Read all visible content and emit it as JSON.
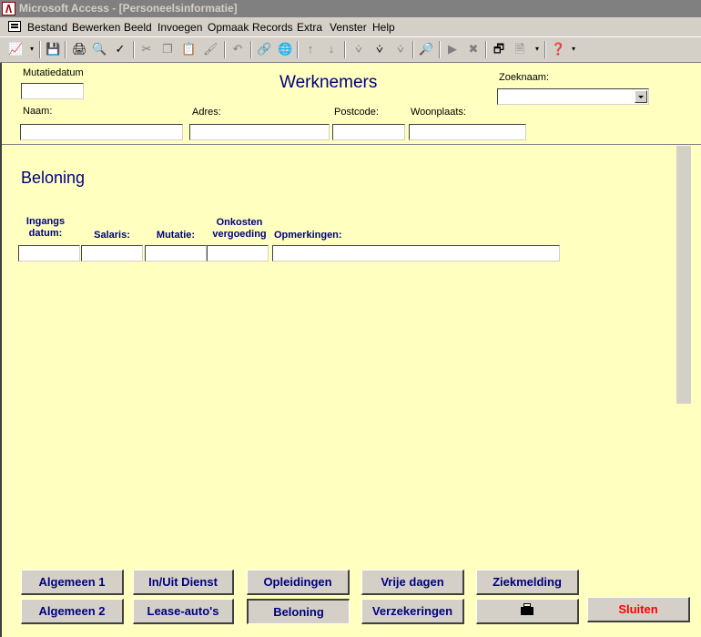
{
  "window": {
    "title": "Microsoft Access - [Personeelsinformatie]"
  },
  "menu": [
    "Bestand",
    "Bewerken",
    "Beeld",
    "Invoegen",
    "Opmaak",
    "Records",
    "Extra",
    "Venster",
    "Help"
  ],
  "form": {
    "title": "Werknemers",
    "mutatiedatum_label": "Mutatiedatum",
    "zoeknaam_label": "Zoeknaam:",
    "naam_label": "Naam:",
    "adres_label": "Adres:",
    "postcode_label": "Postcode:",
    "woonplaats_label": "Woonplaats:",
    "mutatiedatum_value": "",
    "zoeknaam_value": "",
    "naam_value": "",
    "adres_value": "",
    "postcode_value": "",
    "woonplaats_value": ""
  },
  "section": {
    "title": "Beloning",
    "columns": [
      "Ingangs datum:",
      "Salaris:",
      "Mutatie:",
      "Onkosten vergoeding",
      "Opmerkingen:"
    ],
    "row": {
      "ingangsdatum": "",
      "salaris": "",
      "mutatie": "",
      "onkosten": "",
      "opmerkingen": ""
    }
  },
  "buttons": {
    "algemeen1": "Algemeen 1",
    "inuit": "In/Uit Dienst",
    "opleidingen": "Opleidingen",
    "vrijedagen": "Vrije dagen",
    "ziekmelding": "Ziekmelding",
    "algemeen2": "Algemeen 2",
    "lease": "Lease-auto's",
    "beloning": "Beloning",
    "verzekeringen": "Verzekeringen",
    "print_icon": "printer-icon",
    "sluiten": "Sluiten"
  },
  "colors": {
    "form_bg": "#ffffc0",
    "accent": "#000080",
    "close_text": "#ff0000"
  }
}
